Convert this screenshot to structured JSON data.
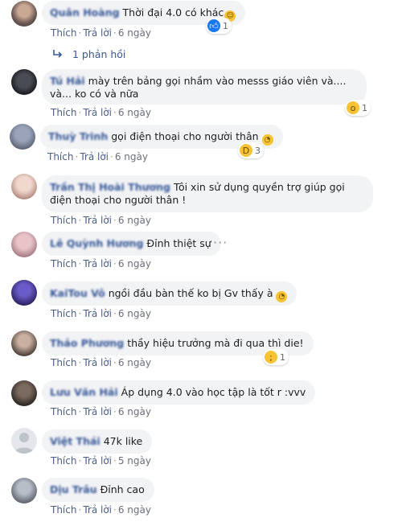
{
  "comments": [
    {
      "author": "Quân Hoàng",
      "text": "Thời đại 4.0 có khác",
      "trailing_emoji": "rolling-on-floor-laughing-emoji",
      "actions": {
        "like": "Thích",
        "reply": "Trả lời",
        "time": "6 ngày"
      },
      "reaction": {
        "icon": "like-icon",
        "count": "1"
      }
    },
    {
      "author": "Tú Hải",
      "text": "mày trên bảng gọi nhầm vào messs giáo viên và.... và... ko có và nữa",
      "actions": {
        "like": "Thích",
        "reply": "Trả lời",
        "time": "6 ngày"
      },
      "reaction": {
        "icon": "wow-icon",
        "count": "1"
      }
    },
    {
      "author": "Thuỳ Trinh",
      "text": "gọi điện thoại cho người thân",
      "trailing_emoji": "pacman-emoji",
      "actions": {
        "like": "Thích",
        "reply": "Trả lời",
        "time": "6 ngày"
      },
      "reaction": {
        "icon": "haha-icon",
        "count": "3"
      }
    },
    {
      "author": "Trần Thị Hoài Thương",
      "text": "Tôi xin sử dụng quyền trợ giúp gọi điện thoại cho người thân !",
      "actions": {
        "like": "Thích",
        "reply": "Trả lời",
        "time": "6 ngày"
      }
    },
    {
      "author": "Lê Quỳnh Hương",
      "text": "Đỉnh thiệt sự",
      "actions": {
        "like": "Thích",
        "reply": "Trả lời",
        "time": "6 ngày"
      },
      "more": "···"
    },
    {
      "author": "KaiTou Vô",
      "text": "ngồi đầu bàn thế ko bị Gv thấy à",
      "trailing_emoji": "pacman-emoji",
      "actions": {
        "like": "Thích",
        "reply": "Trả lời",
        "time": "6 ngày"
      }
    },
    {
      "author": "Thảo Phương",
      "text": "thầy hiệu trưởng mà đi qua thì die!",
      "actions": {
        "like": "Thích",
        "reply": "Trả lời",
        "time": "6 ngày"
      },
      "reaction": {
        "icon": "sad-icon",
        "count": "1"
      }
    },
    {
      "author": "Lưu Văn Hải",
      "text": "Áp dụng 4.0 vào học tập là tốt r :vvv",
      "actions": {
        "like": "Thích",
        "reply": "Trả lời",
        "time": "6 ngày"
      }
    },
    {
      "author": "Việt Thái",
      "text": "47k like",
      "actions": {
        "like": "Thích",
        "reply": "Trả lời",
        "time": "5 ngày"
      }
    },
    {
      "author": "Dịu Trâu",
      "text": "Đỉnh cao",
      "actions": {
        "like": "Thích",
        "reply": "Trả lời",
        "time": "6 ngày"
      }
    }
  ],
  "replies_link": {
    "icon": "reply-arrow-icon",
    "label": "1 phản hồi"
  },
  "colors": {
    "link": "#385898",
    "bubble": "#f2f3f5",
    "like": "#1877f2",
    "emoji": "#f7c234"
  }
}
